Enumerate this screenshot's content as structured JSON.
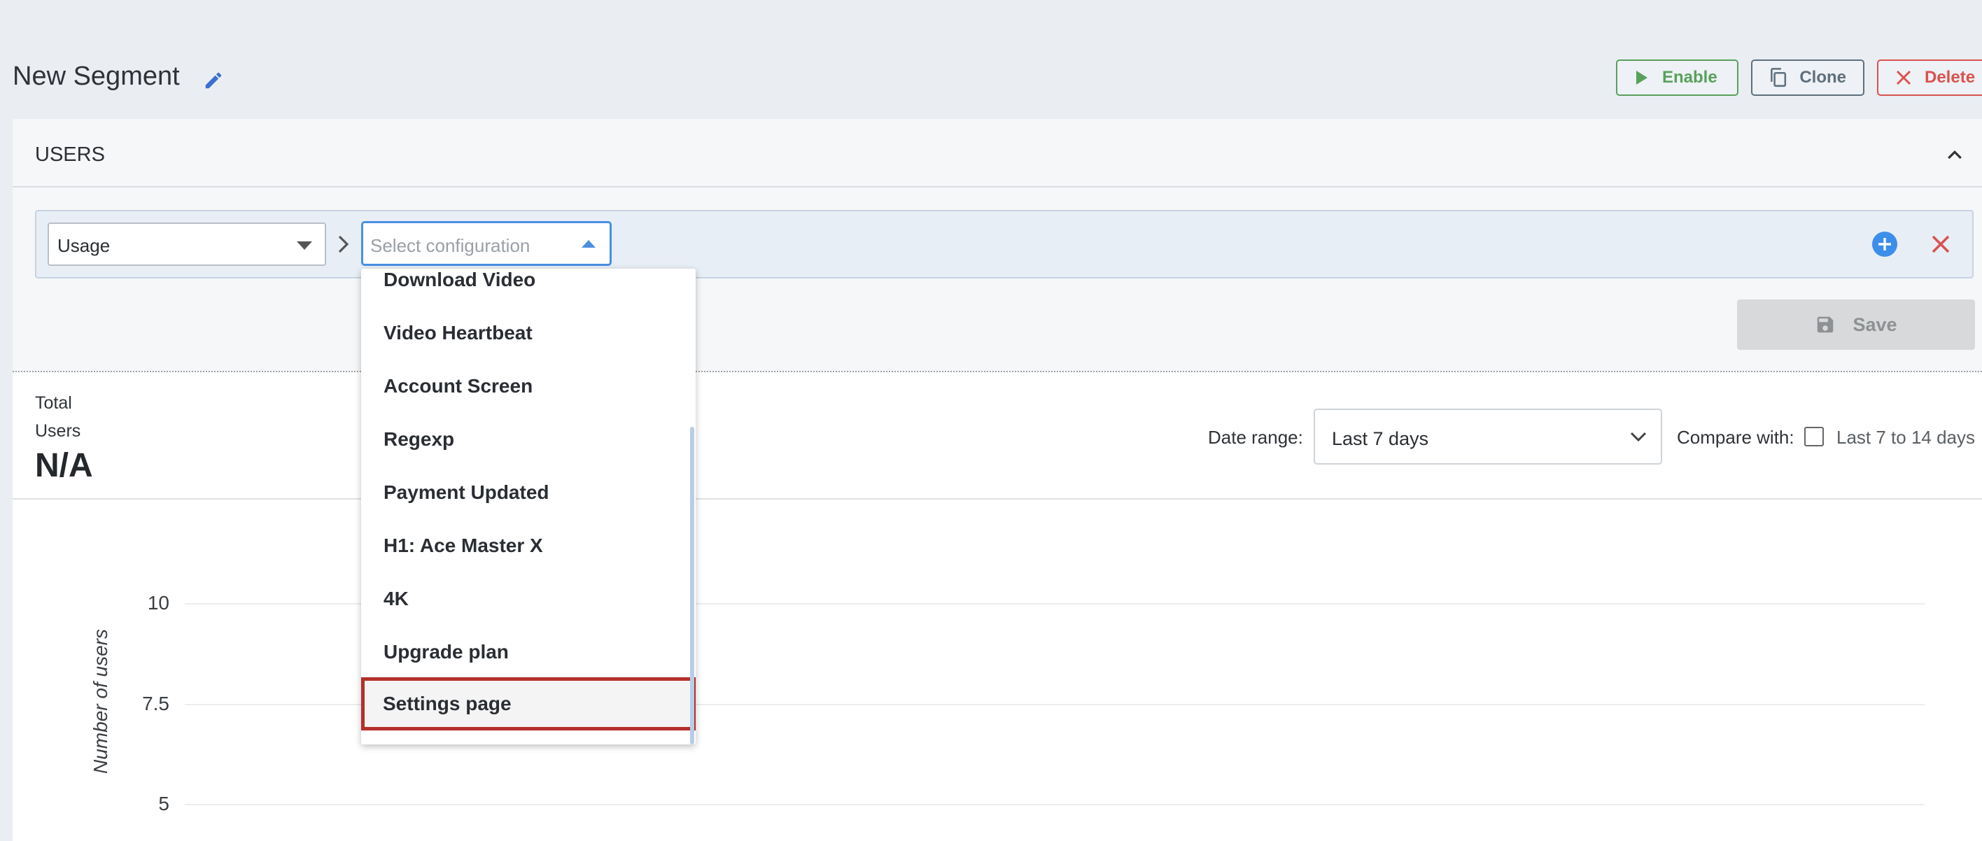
{
  "header": {
    "title": "New Segment",
    "enable_label": "Enable",
    "clone_label": "Clone",
    "delete_label": "Delete"
  },
  "panel": {
    "title": "USERS"
  },
  "filter": {
    "type_value": "Usage",
    "config_placeholder": "Select configuration",
    "options": [
      "Download Video",
      "Video Heartbeat",
      "Account Screen",
      "Regexp",
      "Payment Updated",
      "H1: Ace Master X",
      "4K",
      "Upgrade plan",
      "Settings page"
    ],
    "highlighted_option": "Settings page",
    "save_label": "Save"
  },
  "stats": {
    "total_label": "Total Users",
    "total_value": "N/A",
    "date_range_label": "Date range:",
    "date_range_value": "Last 7 days",
    "compare_label": "Compare with:",
    "compare_option": "Last 7 to 14 days"
  },
  "chart_data": {
    "type": "line",
    "ylabel": "Number of users",
    "yticks": [
      "10",
      "7.5",
      "5"
    ]
  },
  "colors": {
    "accent": "#4a8fe2",
    "enable": "#58a15c",
    "delete": "#d9534f",
    "highlight": "#b4302a"
  }
}
